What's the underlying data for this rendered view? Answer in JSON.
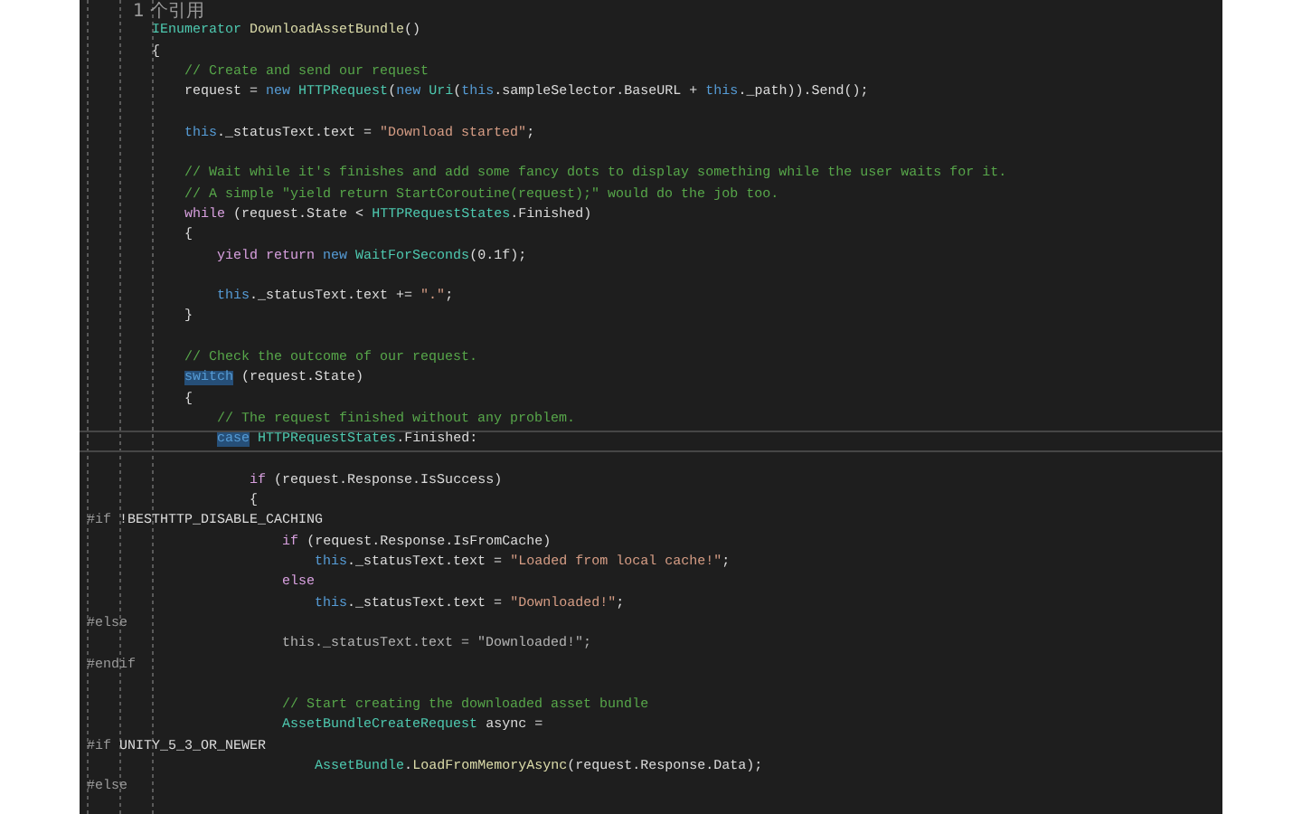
{
  "editor": {
    "lines": [
      {
        "kind": "lens",
        "segments": [
          {
            "kind": "lens",
            "text": "        1 个引用"
          }
        ]
      },
      {
        "kind": "code",
        "segments": [
          {
            "kind": "type",
            "text": "        IEnumerator "
          },
          {
            "kind": "method",
            "text": "DownloadAssetBundle"
          },
          {
            "kind": "plain",
            "text": "()"
          }
        ]
      },
      {
        "kind": "code",
        "segments": [
          {
            "kind": "plain",
            "text": "        {"
          }
        ]
      },
      {
        "kind": "code",
        "segments": [
          {
            "kind": "comment",
            "text": "            // Create and send our request"
          }
        ]
      },
      {
        "kind": "code",
        "segments": [
          {
            "kind": "plain",
            "text": "            request = "
          },
          {
            "kind": "keyword",
            "text": "new "
          },
          {
            "kind": "type",
            "text": "HTTPRequest"
          },
          {
            "kind": "plain",
            "text": "("
          },
          {
            "kind": "keyword",
            "text": "new "
          },
          {
            "kind": "type",
            "text": "Uri"
          },
          {
            "kind": "plain",
            "text": "("
          },
          {
            "kind": "keyword",
            "text": "this"
          },
          {
            "kind": "plain",
            "text": ".sampleSelector.BaseURL + "
          },
          {
            "kind": "keyword",
            "text": "this"
          },
          {
            "kind": "plain",
            "text": "._path)).Send();"
          }
        ]
      },
      {
        "kind": "blank"
      },
      {
        "kind": "code",
        "segments": [
          {
            "kind": "keyword",
            "text": "            this"
          },
          {
            "kind": "plain",
            "text": "._statusText.text = "
          },
          {
            "kind": "string",
            "text": "\"Download started\""
          },
          {
            "kind": "plain",
            "text": ";"
          }
        ]
      },
      {
        "kind": "blank"
      },
      {
        "kind": "code",
        "segments": [
          {
            "kind": "comment",
            "text": "            // Wait while it's finishes and add some fancy dots to display something while the user waits for it."
          }
        ]
      },
      {
        "kind": "code",
        "segments": [
          {
            "kind": "comment",
            "text": "            // A simple \"yield return StartCoroutine(request);\" would do the job too."
          }
        ]
      },
      {
        "kind": "code",
        "segments": [
          {
            "kind": "control",
            "text": "            while"
          },
          {
            "kind": "plain",
            "text": " (request.State < "
          },
          {
            "kind": "type",
            "text": "HTTPRequestStates"
          },
          {
            "kind": "plain",
            "text": ".Finished)"
          }
        ]
      },
      {
        "kind": "code",
        "segments": [
          {
            "kind": "plain",
            "text": "            {"
          }
        ]
      },
      {
        "kind": "code",
        "segments": [
          {
            "kind": "control",
            "text": "                yield return "
          },
          {
            "kind": "keyword",
            "text": "new "
          },
          {
            "kind": "type",
            "text": "WaitForSeconds"
          },
          {
            "kind": "plain",
            "text": "(0.1f);"
          }
        ]
      },
      {
        "kind": "blank"
      },
      {
        "kind": "code",
        "segments": [
          {
            "kind": "keyword",
            "text": "                this"
          },
          {
            "kind": "plain",
            "text": "._statusText.text += "
          },
          {
            "kind": "string",
            "text": "\".\""
          },
          {
            "kind": "plain",
            "text": ";"
          }
        ]
      },
      {
        "kind": "code",
        "segments": [
          {
            "kind": "plain",
            "text": "            }"
          }
        ]
      },
      {
        "kind": "blank"
      },
      {
        "kind": "code",
        "segments": [
          {
            "kind": "comment",
            "text": "            // Check the outcome of our request."
          }
        ]
      },
      {
        "kind": "code",
        "segments": [
          {
            "kind": "highlight",
            "text": "            switch"
          },
          {
            "kind": "plain",
            "text": " (request.State)"
          }
        ]
      },
      {
        "kind": "code",
        "segments": [
          {
            "kind": "plain",
            "text": "            {"
          }
        ]
      },
      {
        "kind": "code",
        "segments": [
          {
            "kind": "comment",
            "text": "                // The request finished without any problem."
          }
        ]
      },
      {
        "kind": "current",
        "segments": [
          {
            "kind": "highlight",
            "text": "                case"
          },
          {
            "kind": "type",
            "text": " HTTPRequestStates"
          },
          {
            "kind": "plain",
            "text": ".Finished:"
          }
        ]
      },
      {
        "kind": "blank"
      },
      {
        "kind": "code",
        "segments": [
          {
            "kind": "control",
            "text": "                    if"
          },
          {
            "kind": "plain",
            "text": " (request.Response.IsSuccess)"
          }
        ]
      },
      {
        "kind": "code",
        "segments": [
          {
            "kind": "plain",
            "text": "                    {"
          }
        ]
      },
      {
        "kind": "code",
        "segments": [
          {
            "kind": "preproc",
            "text": "#if"
          },
          {
            "kind": "plain",
            "text": " !BESTHTTP_DISABLE_CACHING"
          }
        ]
      },
      {
        "kind": "code",
        "segments": [
          {
            "kind": "control",
            "text": "                        if"
          },
          {
            "kind": "plain",
            "text": " (request.Response.IsFromCache)"
          }
        ]
      },
      {
        "kind": "code",
        "segments": [
          {
            "kind": "keyword",
            "text": "                            this"
          },
          {
            "kind": "plain",
            "text": "._statusText.text = "
          },
          {
            "kind": "string",
            "text": "\"Loaded from local cache!\""
          },
          {
            "kind": "plain",
            "text": ";"
          }
        ]
      },
      {
        "kind": "code",
        "segments": [
          {
            "kind": "control",
            "text": "                        else"
          }
        ]
      },
      {
        "kind": "code",
        "segments": [
          {
            "kind": "keyword",
            "text": "                            this"
          },
          {
            "kind": "plain",
            "text": "._statusText.text = "
          },
          {
            "kind": "string",
            "text": "\"Downloaded!\""
          },
          {
            "kind": "plain",
            "text": ";"
          }
        ]
      },
      {
        "kind": "code",
        "segments": [
          {
            "kind": "preproc",
            "text": "#else"
          }
        ]
      },
      {
        "kind": "code",
        "segments": [
          {
            "kind": "inactive",
            "text": "                        this._statusText.text = \"Downloaded!\";"
          }
        ]
      },
      {
        "kind": "code",
        "segments": [
          {
            "kind": "preproc",
            "text": "#endif"
          }
        ]
      },
      {
        "kind": "blank"
      },
      {
        "kind": "code",
        "segments": [
          {
            "kind": "comment",
            "text": "                        // Start creating the downloaded asset bundle"
          }
        ]
      },
      {
        "kind": "code",
        "segments": [
          {
            "kind": "type",
            "text": "                        AssetBundleCreateRequest"
          },
          {
            "kind": "plain",
            "text": " async ="
          }
        ]
      },
      {
        "kind": "code",
        "segments": [
          {
            "kind": "preproc",
            "text": "#if"
          },
          {
            "kind": "plain",
            "text": " UNITY_5_3_OR_NEWER"
          }
        ]
      },
      {
        "kind": "code",
        "segments": [
          {
            "kind": "type",
            "text": "                            AssetBundle"
          },
          {
            "kind": "plain",
            "text": "."
          },
          {
            "kind": "method",
            "text": "LoadFromMemoryAsync"
          },
          {
            "kind": "plain",
            "text": "(request.Response.Data);"
          }
        ]
      },
      {
        "kind": "code",
        "segments": [
          {
            "kind": "preproc",
            "text": "#else"
          }
        ]
      }
    ]
  }
}
